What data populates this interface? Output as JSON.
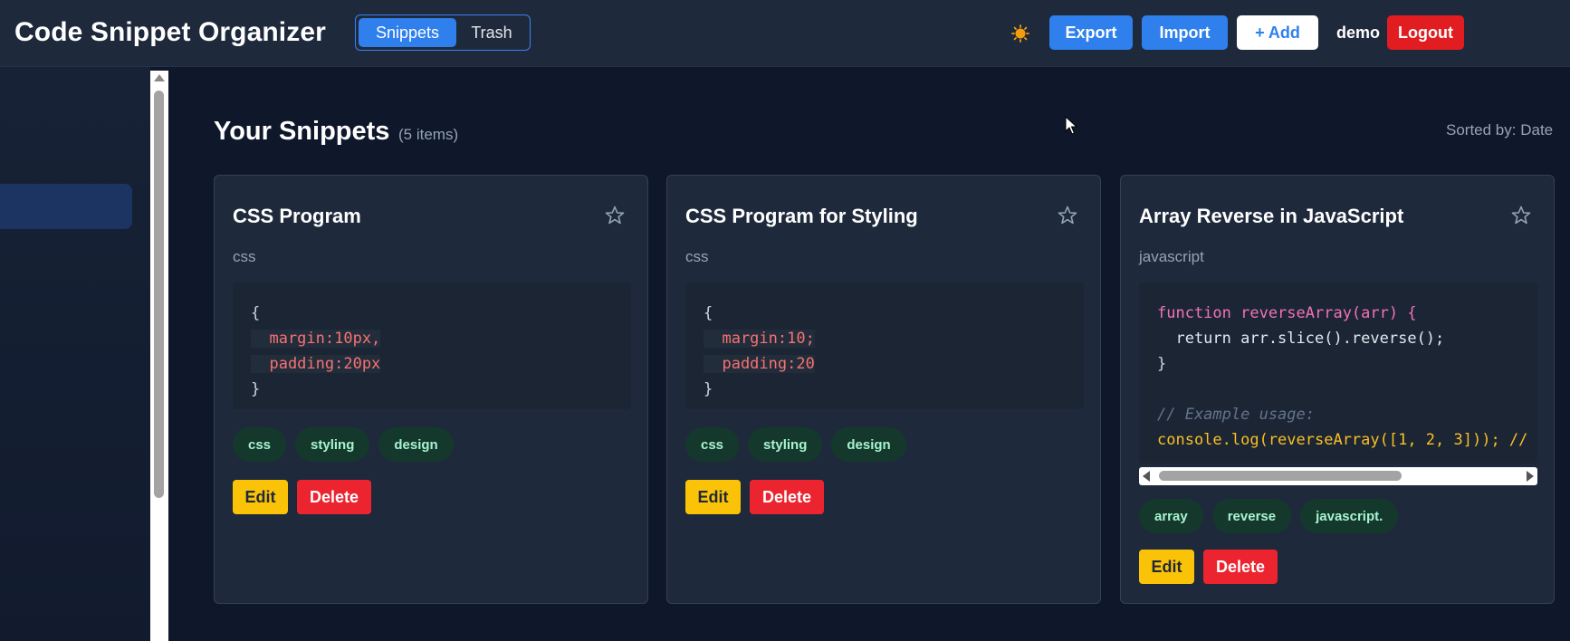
{
  "header": {
    "title": "Code Snippet Organizer",
    "tabs": [
      {
        "label": "Snippets",
        "active": true
      },
      {
        "label": "Trash",
        "active": false
      }
    ],
    "theme_icon": "sun-icon",
    "export_label": "Export",
    "import_label": "Import",
    "add_label": "+ Add",
    "username": "demo",
    "logout_label": "Logout"
  },
  "main": {
    "title": "Your Snippets",
    "count": "(5 items)",
    "sort": "Sorted by: Date"
  },
  "cards": [
    {
      "title": "CSS Program",
      "language": "css",
      "code": [
        "{",
        "  margin:10px,",
        "  padding:20px",
        "}"
      ],
      "tags": [
        "css",
        "styling",
        "design"
      ],
      "edit_label": "Edit",
      "delete_label": "Delete"
    },
    {
      "title": "CSS Program for Styling",
      "language": "css",
      "code": [
        "{",
        "  margin:10;",
        "  padding:20",
        "}"
      ],
      "tags": [
        "css",
        "styling",
        "design"
      ],
      "edit_label": "Edit",
      "delete_label": "Delete"
    },
    {
      "title": "Array Reverse in JavaScript",
      "language": "javascript",
      "code": [
        "function reverseArray(arr) {",
        "  return arr.slice().reverse();",
        "}",
        "",
        "// Example usage:",
        "console.log(reverseArray([1, 2, 3])); //"
      ],
      "tags": [
        "array",
        "reverse",
        "javascript."
      ],
      "edit_label": "Edit",
      "delete_label": "Delete"
    }
  ],
  "colors": {
    "background": "#0f172a",
    "header": "#1e293b",
    "accent": "#2f80ed",
    "danger": "#e11d21",
    "edit": "#fbc308",
    "tag_bg": "#14392c"
  }
}
